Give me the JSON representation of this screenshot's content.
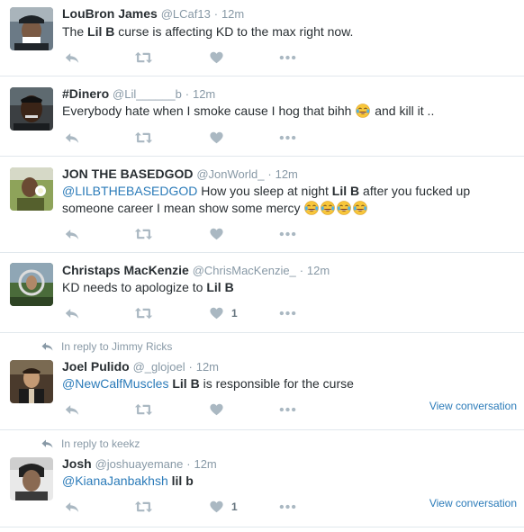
{
  "tweets": [
    {
      "name": "LouBron James",
      "handle": "@LCaf13",
      "dot": "·",
      "time": "12m",
      "t1": "The ",
      "b1": "Lil B",
      "t2": " curse is affecting KD to the max right now.",
      "like_count": ""
    },
    {
      "name": "#Dinero",
      "handle": "@Lil______b",
      "dot": "·",
      "time": "12m",
      "t1": "Everybody hate when I smoke cause I hog that bihh ",
      "t2": " and kill it ..",
      "like_count": ""
    },
    {
      "name": "JON THE BASEDGOD",
      "handle": "@JonWorld_",
      "dot": "·",
      "time": "12m",
      "mention": "@LILBTHEBASEDGOD",
      "t1": " How you sleep at night ",
      "b1": "Lil B",
      "t2": " after you fucked up someone career I mean show some mercy ",
      "like_count": ""
    },
    {
      "name": "Christaps MacKenzie",
      "handle": "@ChrisMacKenzie_",
      "dot": "·",
      "time": "12m",
      "t1": "KD needs to apologize to ",
      "b1": "Lil B",
      "like_count": "1"
    },
    {
      "reply_context": "In reply to Jimmy Ricks",
      "name": "Joel Pulido",
      "handle": "@_glojoel",
      "dot": "·",
      "time": "12m",
      "mention": "@NewCalfMuscles",
      "t1": " ",
      "b1": "Lil B",
      "t2": " is responsible for the curse",
      "like_count": "",
      "view_conversation": "View conversation"
    },
    {
      "reply_context": "In reply to keekz",
      "name": "Josh",
      "handle": "@joshuayemane",
      "dot": "·",
      "time": "12m",
      "mention": "@KianaJanbakhsh",
      "t1": " ",
      "b1": "lil b",
      "like_count": "1",
      "view_conversation": "View conversation"
    }
  ],
  "icons": {
    "reply": "reply-icon",
    "retweet": "retweet-icon",
    "like": "heart-icon",
    "more": "more-icon",
    "emoji": "face-with-tears-of-joy-emoji"
  },
  "colors": {
    "link": "#2b7bb9",
    "muted": "#8899a6",
    "action_icon": "#aab8c2",
    "divider": "#e1e8ed"
  }
}
